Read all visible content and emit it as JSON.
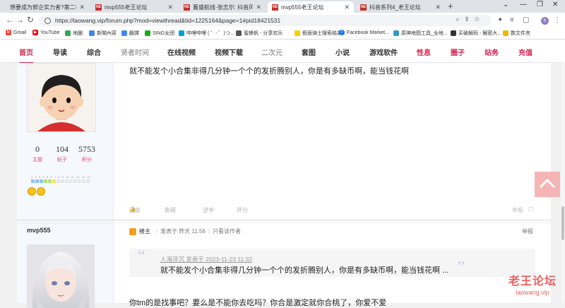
{
  "tabs": [
    {
      "label": "想要成为郭企实力者?第二季-…",
      "active": false
    },
    {
      "label": "mvp555老王论坛",
      "active": false
    },
    {
      "label": "蓄盛航线·张志尔: 抖音风景推…",
      "active": false
    },
    {
      "label": "mvp555老王论坛",
      "active": true
    },
    {
      "label": "抖音系列4_老王论坛",
      "active": false
    }
  ],
  "address": {
    "url": "https://laowang.vip/forum.php?mod=viewthread&tid=1225164&page=1#pid18421531"
  },
  "profile_initial": "h",
  "bookmarks": [
    {
      "label": "Gmail",
      "color": "#ea4335"
    },
    {
      "label": "YouTube",
      "color": "#ff0000"
    },
    {
      "label": "地圖",
      "color": "#34a853"
    },
    {
      "label": "新聞內容",
      "color": "#4285f4"
    },
    {
      "label": "翻譯",
      "color": "#4285f4"
    },
    {
      "label": "SING女团",
      "color": "#1aad19"
    },
    {
      "label": "哔哩哔哩 ( ゜- ゜)つ...",
      "color": "#00a1d6"
    },
    {
      "label": "蜜蜂帆 - 分享欢乐",
      "color": "#555555"
    },
    {
      "label": "假面骑士搜索结果...",
      "color": "#ffcc00"
    },
    {
      "label": "Facebook Market...",
      "color": "#1877f2"
    },
    {
      "label": "原神地图工具_全地...",
      "color": "#3399cc"
    },
    {
      "label": "买破解码 - 解密大...",
      "color": "#333333"
    },
    {
      "label": "数文件夹",
      "color": "#f2b705"
    }
  ],
  "site_nav": [
    {
      "label": "首页",
      "style": "cur"
    },
    {
      "label": "导读",
      "style": "normal"
    },
    {
      "label": "综合",
      "style": "normal"
    },
    {
      "label": "贤者时间",
      "style": "gray"
    },
    {
      "label": "在线视频",
      "style": "normal"
    },
    {
      "label": "视频下载",
      "style": "normal"
    },
    {
      "label": "二次元",
      "style": "gray"
    },
    {
      "label": "套图",
      "style": "normal"
    },
    {
      "label": "小说",
      "style": "normal"
    },
    {
      "label": "游戏软件",
      "style": "normal"
    },
    {
      "label": "性息",
      "style": "red"
    },
    {
      "label": "圈子",
      "style": "red"
    },
    {
      "label": "站务",
      "style": "red"
    },
    {
      "label": "充值",
      "style": "red"
    }
  ],
  "post1": {
    "text": "就不能发个小合集非得几分钟一个个的发折腾别人，你是有多缺币啊，能当钱花啊",
    "stats": [
      {
        "num": "0",
        "label": "主题"
      },
      {
        "num": "104",
        "label": "帖子"
      },
      {
        "num": "5753",
        "label": "积分"
      }
    ],
    "level_ticks": [
      "1",
      "2",
      "3",
      "4",
      "5",
      "6",
      "7",
      "8",
      "9",
      "10",
      "11",
      "12",
      "13",
      "14"
    ],
    "footer": {
      "like": "回复",
      "fav": "收藏",
      "share": "分享",
      "quote": "评分",
      "report": "举报"
    },
    "level_progress": 0.43
  },
  "post2": {
    "username": "mvp555",
    "badge": "楼主",
    "posted": "发表于 昨天 11:56",
    "only_author": "只看该作者",
    "report": "举报",
    "quote_head": "人海浮沉 发表于 2023-11-23 11:32",
    "quote_body": "就不能发个小合集非得几分钟一个个的发折腾别人，你是有多缺币啊，能当钱花啊 ...",
    "text": "你tm的是找事吧？要么是不能你去吃吗？你合是激定就你合桃了，你爱不爱"
  },
  "watermark": {
    "line1": "老王论坛",
    "line2": "laowang.vip"
  }
}
